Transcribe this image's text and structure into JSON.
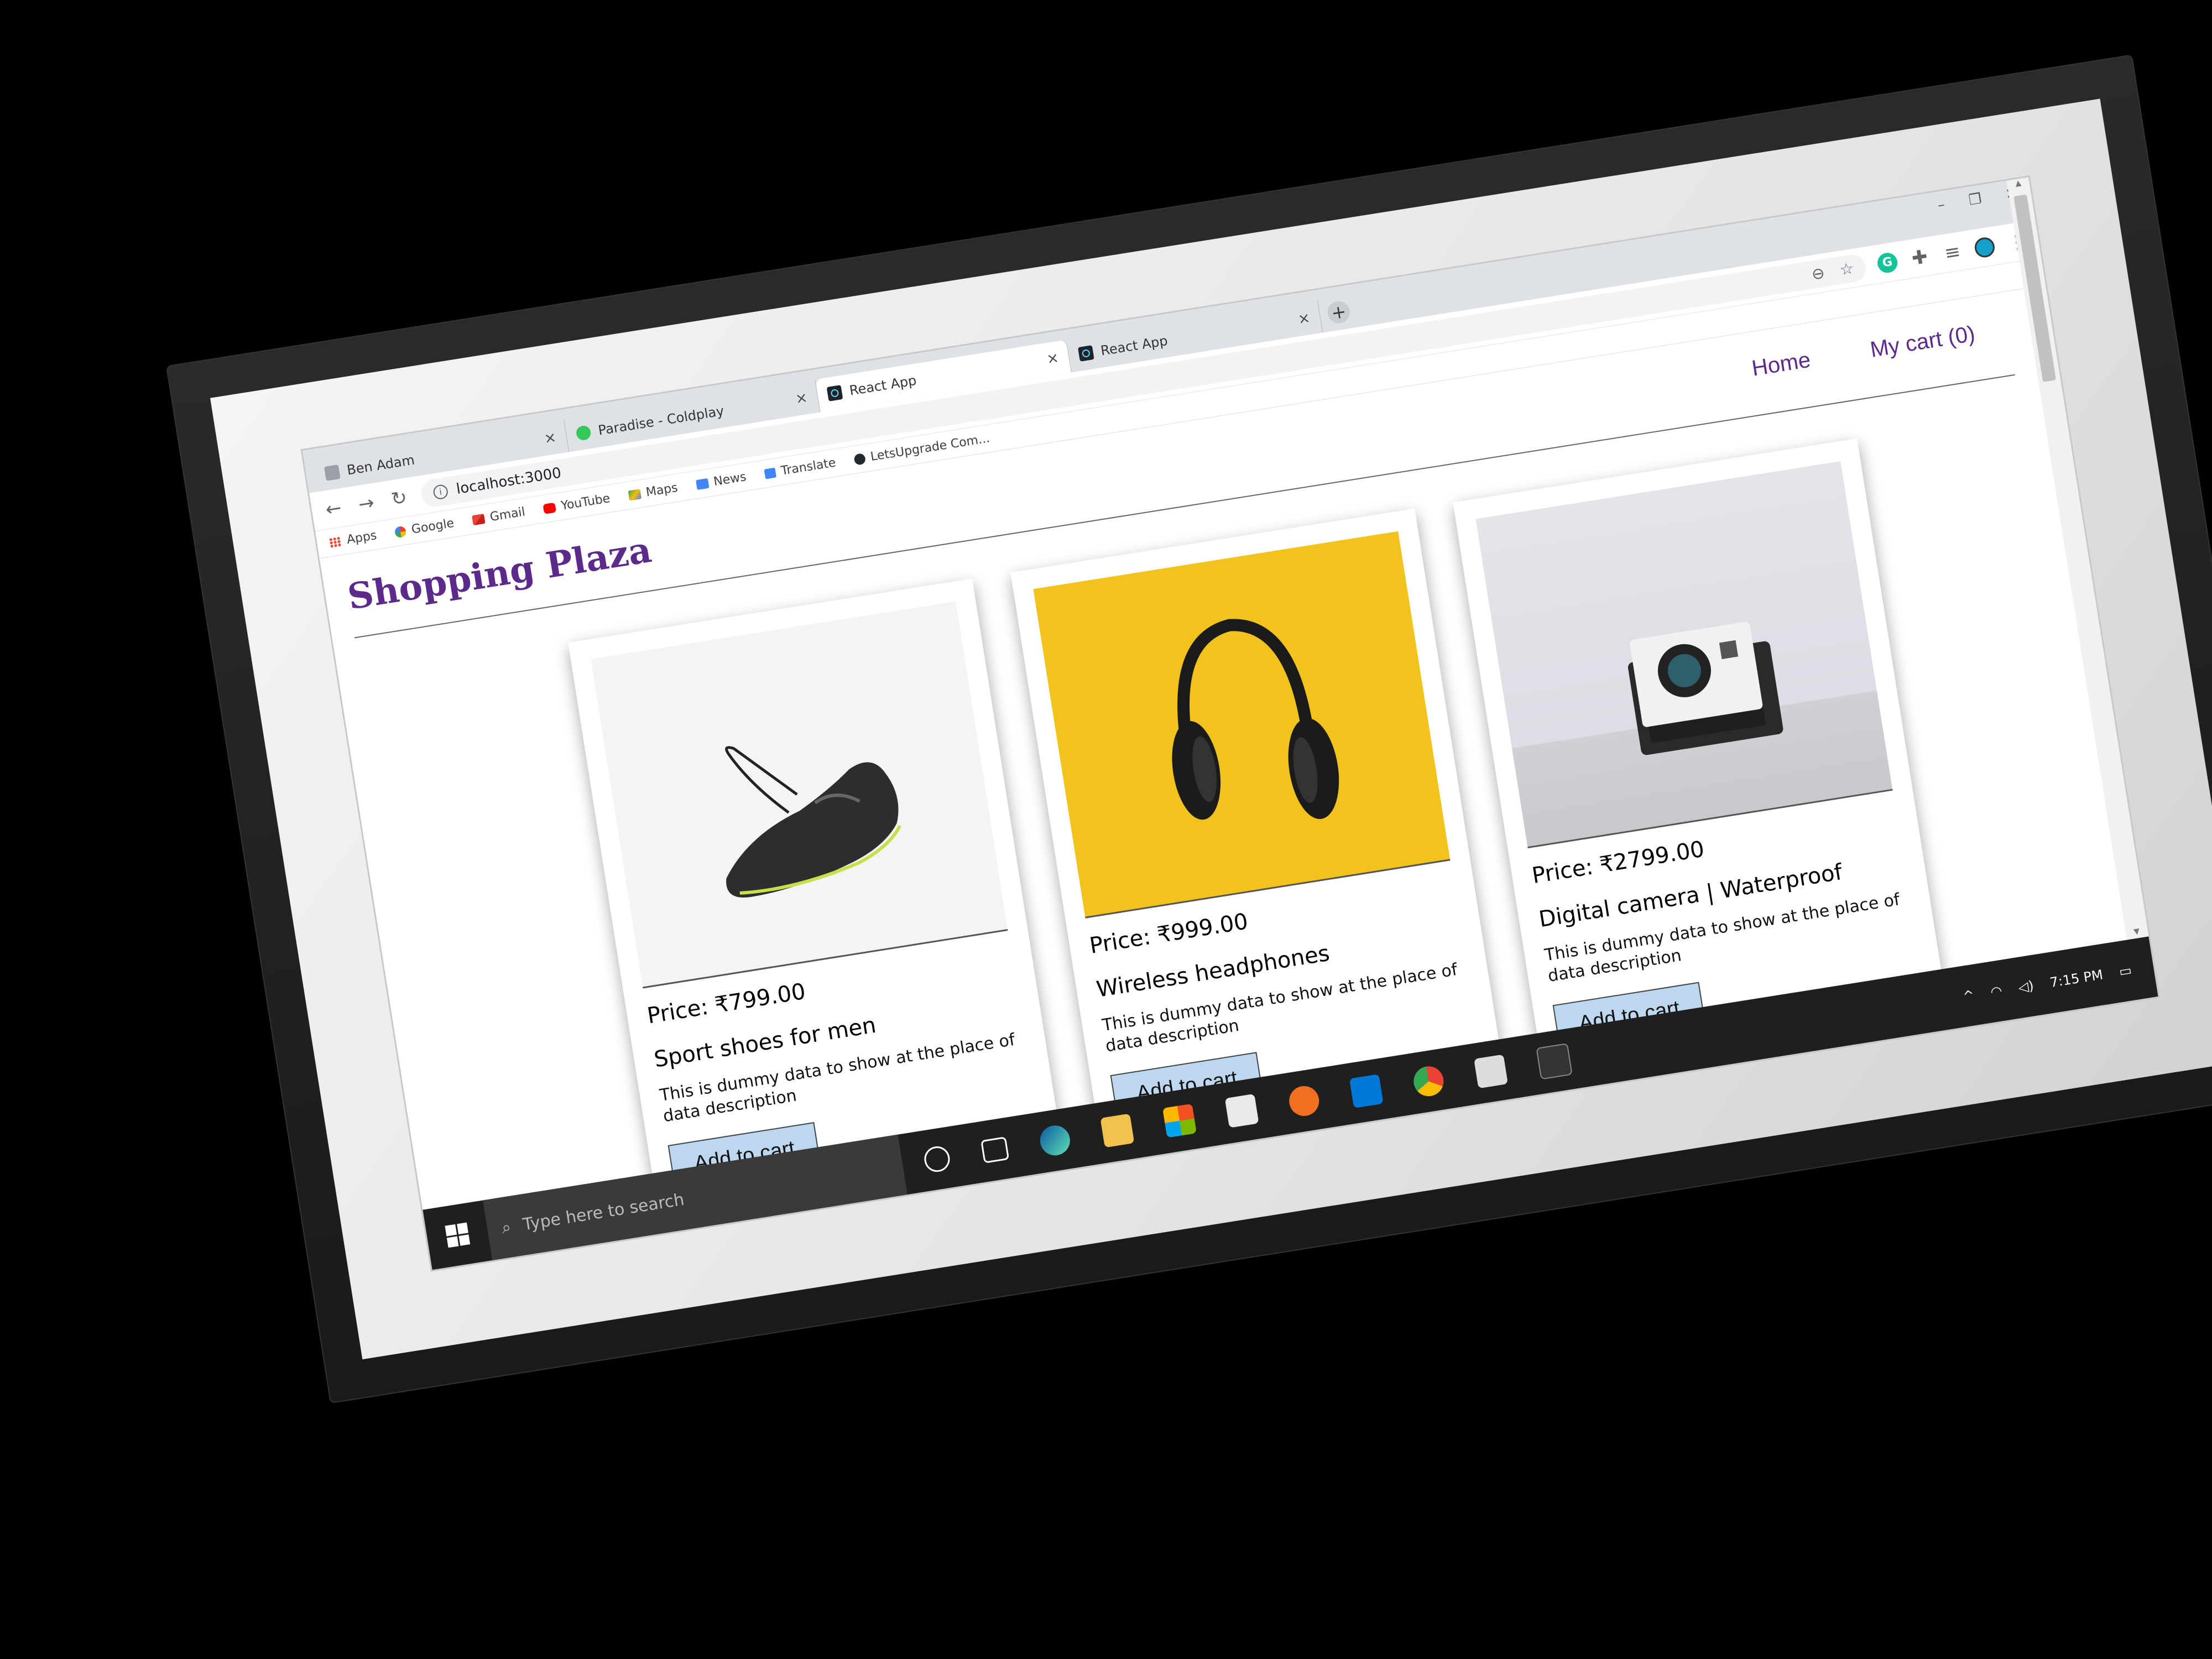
{
  "browser": {
    "tabs": [
      {
        "title": "Ben Adam",
        "active": false
      },
      {
        "title": "Paradise - Coldplay",
        "active": false
      },
      {
        "title": "React App",
        "active": true
      },
      {
        "title": "React App",
        "active": false
      }
    ],
    "url": "localhost:3000",
    "bookmarks": [
      {
        "label": "Apps",
        "icon": "apps-grid-icon"
      },
      {
        "label": "Google",
        "icon": "google-icon"
      },
      {
        "label": "Gmail",
        "icon": "gmail-icon"
      },
      {
        "label": "YouTube",
        "icon": "youtube-icon"
      },
      {
        "label": "Maps",
        "icon": "maps-icon"
      },
      {
        "label": "News",
        "icon": "news-icon"
      },
      {
        "label": "Translate",
        "icon": "translate-icon"
      },
      {
        "label": "LetsUpgrade Com...",
        "icon": "github-icon"
      }
    ]
  },
  "site": {
    "brand": "Shopping Plaza",
    "nav": {
      "home": "Home",
      "cart": "My cart (0)"
    }
  },
  "products": [
    {
      "price": "Price: ₹799.00",
      "name": "Sport shoes for men",
      "description": "This is dummy data to show at the place of data description",
      "button": "Add to cart",
      "image": "shoe-image"
    },
    {
      "price": "Price: ₹999.00",
      "name": "Wireless headphones",
      "description": "This is dummy data to show at the place of data description",
      "button": "Add to cart",
      "image": "headphones-image"
    },
    {
      "price": "Price: ₹2799.00",
      "name": "Digital camera | Waterproof",
      "description": "This is dummy data to show at the place of data description",
      "button": "Add to cart",
      "image": "camera-image"
    }
  ],
  "taskbar": {
    "search_placeholder": "Type here to search",
    "time": "7:15 PM"
  },
  "colors": {
    "brand": "#5b2a8a",
    "button_bg": "#bdd7ef",
    "headphones_bg": "#f2c31c"
  }
}
